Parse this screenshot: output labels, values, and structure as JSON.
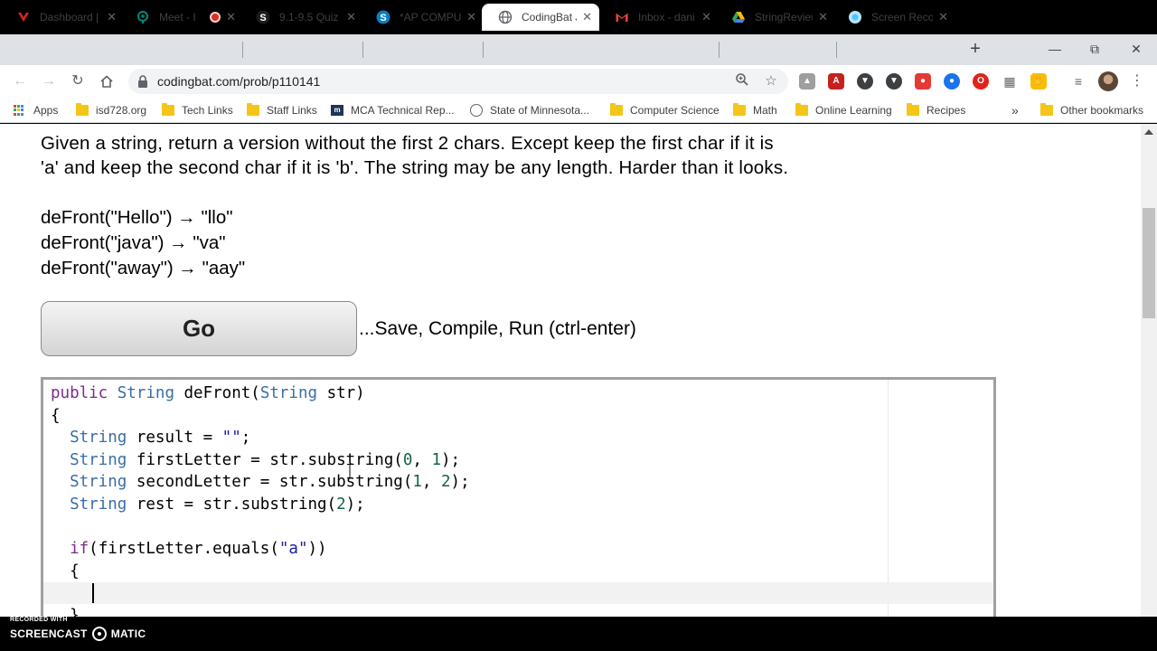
{
  "browser": {
    "tabs": [
      {
        "label": "Dashboard | ",
        "icon": "canvas-icon",
        "color": "#e2231a"
      },
      {
        "label": "Meet - I",
        "icon": "meet-icon",
        "color": "#00897b",
        "recording": true
      },
      {
        "label": "9.1-9.5 Quiz",
        "icon": "schoology-icon",
        "color": "#1c1c1c"
      },
      {
        "label": "*AP COMPU",
        "icon": "schoology-icon",
        "color": "#0a7ec2"
      },
      {
        "label": "CodingBat J",
        "icon": "globe-icon",
        "color": "#5f6368",
        "active": true
      },
      {
        "label": "Inbox - dani",
        "icon": "gmail-icon",
        "color": "#ea4335"
      },
      {
        "label": "StringReview",
        "icon": "drive-icon",
        "color": "#34a853"
      },
      {
        "label": "Screen Reco",
        "icon": "screencastify-icon",
        "color": "#4fc3f7"
      }
    ],
    "url": "codingbat.com/prob/p110141",
    "bookmarks": [
      {
        "label": "Apps",
        "icon": "apps-icon"
      },
      {
        "label": "isd728.org",
        "icon": "folder-icon"
      },
      {
        "label": "Tech Links",
        "icon": "folder-icon"
      },
      {
        "label": "Staff Links",
        "icon": "folder-icon"
      },
      {
        "label": "MCA Technical Rep...",
        "icon": "mca-icon"
      },
      {
        "label": "State of Minnesota...",
        "icon": "globe-icon"
      },
      {
        "label": "Computer Science",
        "icon": "folder-icon"
      },
      {
        "label": "Math",
        "icon": "folder-icon"
      },
      {
        "label": "Online Learning",
        "icon": "folder-icon"
      },
      {
        "label": "Recipes",
        "icon": "folder-icon"
      }
    ],
    "bookmarks_more": "»",
    "other_bookmarks": "Other bookmarks"
  },
  "problem": {
    "description_line1": "Given a string, return a version without the first 2 chars. Except keep the first char if it is",
    "description_line2": "'a' and keep the second char if it is 'b'. The string may be any length. Harder than it looks.",
    "examples": [
      "deFront(\"Hello\") → \"llo\"",
      "deFront(\"java\") → \"va\"",
      "deFront(\"away\") → \"aay\""
    ],
    "go_label": "Go",
    "go_caption": "...Save, Compile, Run (ctrl-enter)"
  },
  "watermark": {
    "recorded_with": "RECORDED WITH",
    "brand_left": "SCREENCAST",
    "brand_right": "MATIC"
  }
}
